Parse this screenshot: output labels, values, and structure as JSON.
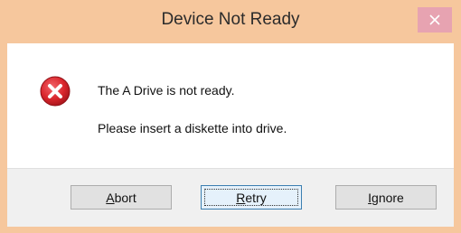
{
  "window": {
    "title": "Device Not Ready",
    "close_glyph": "×"
  },
  "message": {
    "line1": "The A Drive is not ready.",
    "line2": "Please insert a diskette into drive."
  },
  "icon": {
    "name": "error-icon",
    "color": "#d9262c"
  },
  "buttons": {
    "abort": {
      "mnemonic": "A",
      "rest": "bort"
    },
    "retry": {
      "mnemonic": "R",
      "rest": "etry"
    },
    "ignore": {
      "mnemonic": "I",
      "rest": "gnore"
    }
  },
  "colors": {
    "frame": "#f6c79d",
    "close_button": "#e7a3b1",
    "footer": "#f0f0f0"
  }
}
